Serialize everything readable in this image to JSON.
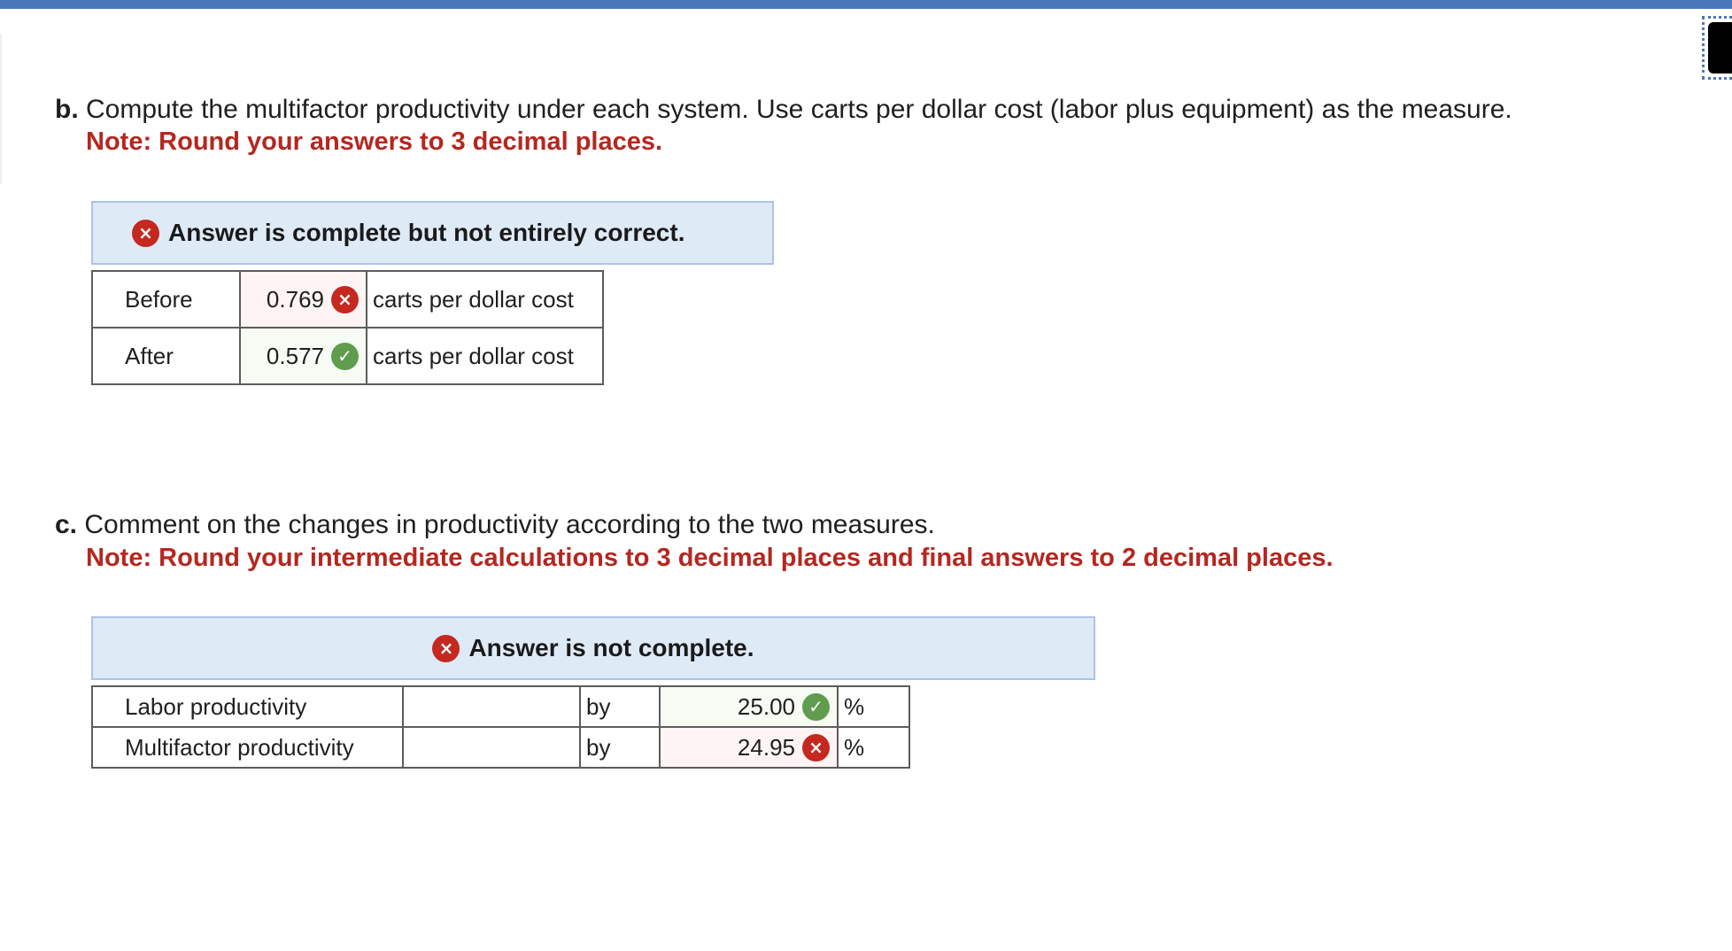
{
  "part_b": {
    "letter": "b.",
    "question": "Compute the multifactor productivity under each system. Use carts per dollar cost (labor plus equipment) as the measure.",
    "note": "Note: Round your answers to 3 decimal places.",
    "banner": "Answer is complete but not entirely correct.",
    "rows": [
      {
        "label": "Before",
        "value": "0.769",
        "status": "incorrect",
        "unit": "carts per dollar cost"
      },
      {
        "label": "After",
        "value": "0.577",
        "status": "correct",
        "unit": "carts per dollar cost"
      }
    ]
  },
  "part_c": {
    "letter": "c.",
    "question": "Comment on the changes in productivity according to the two measures.",
    "note": "Note: Round your intermediate calculations to 3 decimal places and final answers to 2 decimal places.",
    "banner": "Answer is not complete.",
    "rows": [
      {
        "label": "Labor productivity",
        "direction": "",
        "by": "by",
        "value": "25.00",
        "status": "correct",
        "unit": "%"
      },
      {
        "label": "Multifactor productivity",
        "direction": "",
        "by": "by",
        "value": "24.95",
        "status": "incorrect",
        "unit": "%"
      }
    ]
  },
  "icons": {
    "incorrect": "×",
    "correct": "✓"
  },
  "colors": {
    "header_bar": "#4a78b8",
    "note_red": "#b5271f",
    "incorrect_red": "#c4281f",
    "correct_green": "#5f9c4e",
    "banner_bg": "#dfeaf7"
  }
}
